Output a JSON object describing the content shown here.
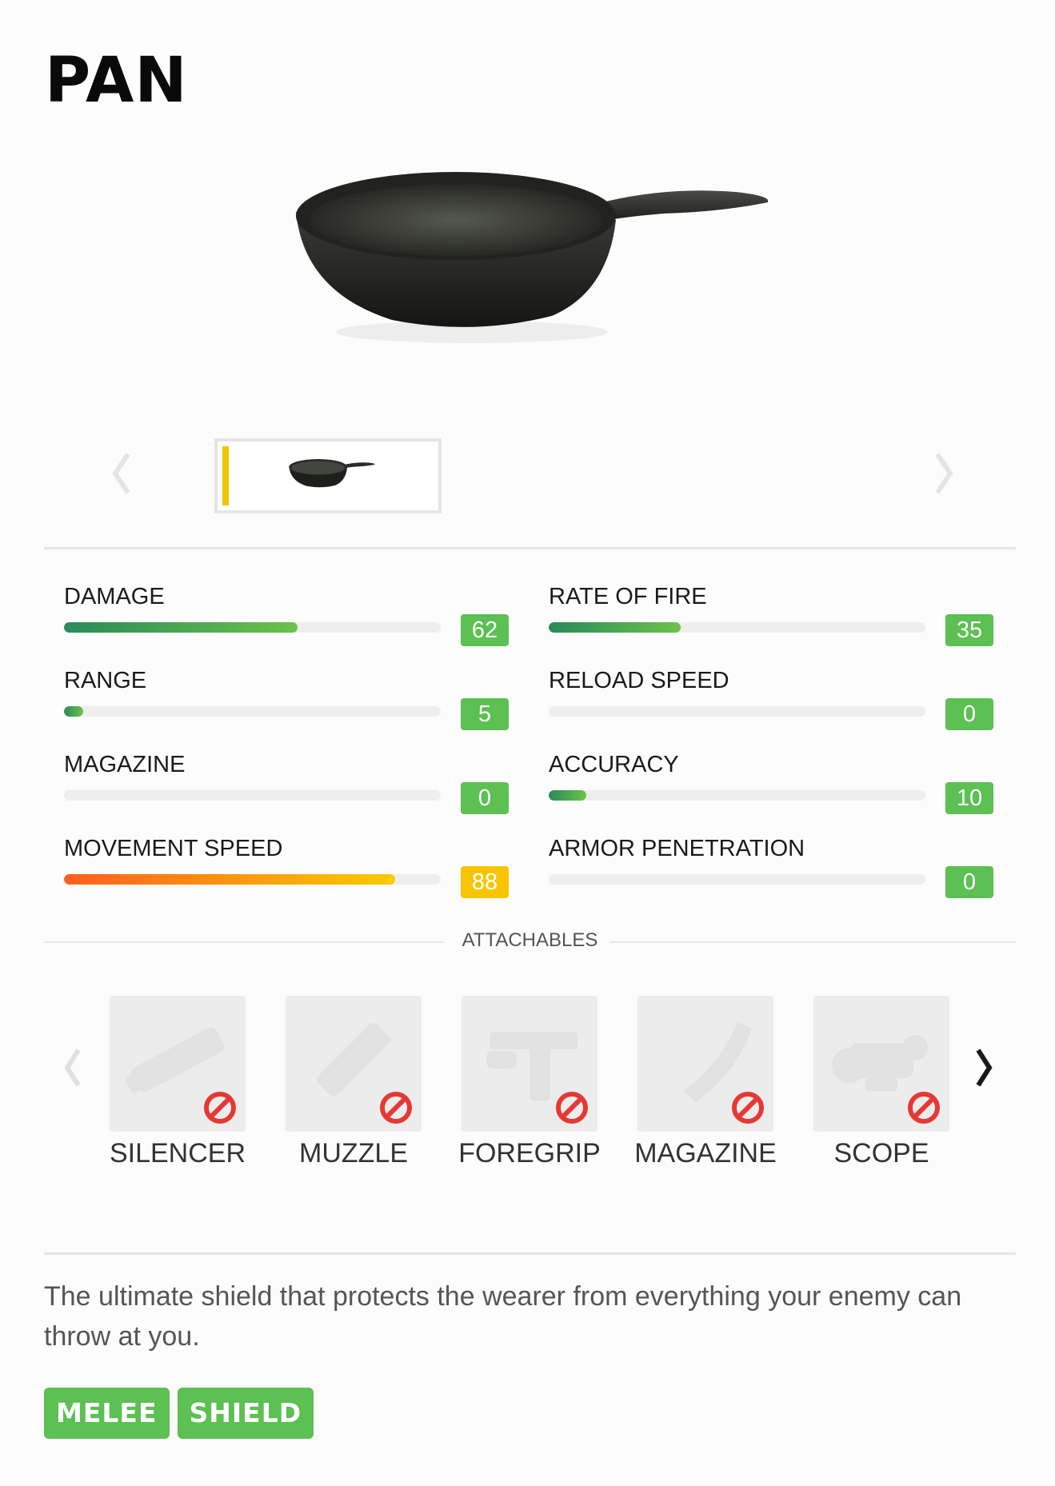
{
  "weapon": {
    "name": "PAN",
    "description": "The ultimate shield that protects the wearer from everything your enemy can throw at you.",
    "image_icon": "frying-pan-icon"
  },
  "stats": [
    {
      "label": "DAMAGE",
      "value": "62",
      "fill_percent": 62,
      "color": "green"
    },
    {
      "label": "RATE OF FIRE",
      "value": "35",
      "fill_percent": 35,
      "color": "green"
    },
    {
      "label": "RANGE",
      "value": "5",
      "fill_percent": 5,
      "color": "green"
    },
    {
      "label": "RELOAD SPEED",
      "value": "0",
      "fill_percent": 0,
      "color": "green"
    },
    {
      "label": "MAGAZINE",
      "value": "0",
      "fill_percent": 0,
      "color": "green"
    },
    {
      "label": "ACCURACY",
      "value": "10",
      "fill_percent": 10,
      "color": "green"
    },
    {
      "label": "MOVEMENT SPEED",
      "value": "88",
      "fill_percent": 88,
      "color": "orange"
    },
    {
      "label": "ARMOR PENETRATION",
      "value": "0",
      "fill_percent": 0,
      "color": "green"
    }
  ],
  "attachables": {
    "header": "ATTACHABLES",
    "slots": [
      {
        "label": "SILENCER",
        "icon": "silencer-icon",
        "status_icon": "not-allowed-icon"
      },
      {
        "label": "MUZZLE",
        "icon": "muzzle-icon",
        "status_icon": "not-allowed-icon"
      },
      {
        "label": "FOREGRIP",
        "icon": "foregrip-icon",
        "status_icon": "not-allowed-icon"
      },
      {
        "label": "MAGAZINE",
        "icon": "magazine-icon",
        "status_icon": "not-allowed-icon"
      },
      {
        "label": "SCOPE",
        "icon": "scope-icon",
        "status_icon": "not-allowed-icon"
      }
    ]
  },
  "tags": [
    "MELEE",
    "SHIELD"
  ],
  "colors": {
    "accent_green": "#5cc052",
    "accent_yellow": "#f8c500",
    "selected_thumb_marker": "#f5c400",
    "not_allowed_red": "#e53935"
  }
}
